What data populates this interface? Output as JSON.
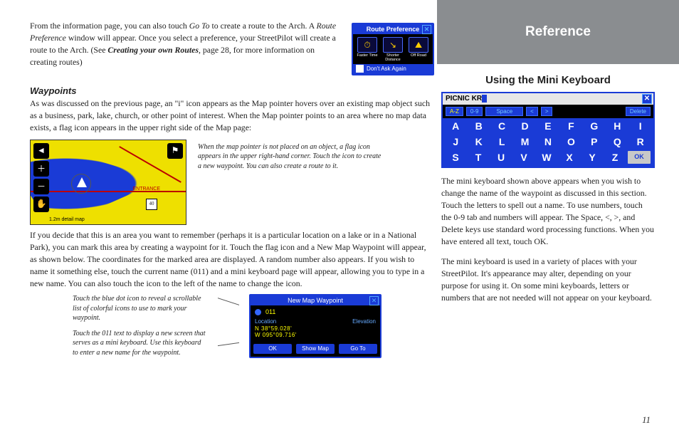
{
  "left": {
    "intro_a": "From the information page, you can also touch ",
    "intro_goto": "Go To",
    "intro_b": " to create a route to the Arch. A ",
    "intro_rp": "Route Preference",
    "intro_c": " window will appear. Once you select a preference, your StreetPilot will create a route to the Arch. (See ",
    "intro_link": "Creating your own Routes",
    "intro_d": ", page 28, for more information on creating routes)",
    "route_pref": {
      "title": "Route Preference",
      "options": [
        "Faster Time",
        "Shorter Distance",
        "Off Road"
      ],
      "glyphs": [
        "⏱",
        "↘",
        "⛰"
      ],
      "dont_ask": "Don't Ask Again"
    },
    "waypoints_h": "Waypoints",
    "waypoints_p1": "As was discussed on the previous page, an \"i\" icon appears as the Map pointer hovers over an existing map object such as a business, park, lake, church, or other point of interest. When the Map pointer points to an area where no map data exists, a flag icon appears in the upper right side of the Map page:",
    "map1": {
      "entrance": "ENTRANCE",
      "scale": "1.2m detail map",
      "shield": "40"
    },
    "cap1": "When the map pointer is not placed on an object, a flag icon appears in the upper right-hand corner. Touch the icon to create a new waypoint. You can also create a route to it.",
    "waypoints_p2_a": "If you decide that this is an area you want to remember (perhaps it is a particular location on a lake or in a National Park), you can mark this area by creating a waypoint for it. Touch the flag icon and a ",
    "waypoints_p2_i": "New Map Waypoint",
    "waypoints_p2_b": " will appear, as shown below. The coordinates for the marked area are displayed. A random number also appears. If you wish to name it something else, touch the current name (011) and a mini keyboard page will appear, allowing you to type in a new name. You can also touch the icon to the left of the name to change the icon.",
    "cap2a": "Touch the blue dot icon to reveal a scrollable list of colorful icons to use to mark your waypoint.",
    "cap2b": "Touch the 011 text to display a new screen that serves as a mini keyboard. Use this keyboard to enter a new name for the waypoint.",
    "nmw": {
      "title": "New Map Waypoint",
      "name": "011",
      "loc_label": "Location",
      "elev_label": "Elevation",
      "lat": "N 38°59.028'",
      "lon": "W 095°09.716'",
      "buttons": [
        "OK",
        "Show Map",
        "Go To"
      ]
    }
  },
  "right": {
    "ref": "Reference",
    "sub": "Using the Mini Keyboard",
    "kbd": {
      "input": "PICNIC KR",
      "tabs": [
        "A-Z",
        "0-9"
      ],
      "space": "Space",
      "lt": "<",
      "gt": ">",
      "del": "Delete",
      "rows": [
        [
          "A",
          "B",
          "C",
          "D",
          "E",
          "F",
          "G",
          "H",
          "I"
        ],
        [
          "J",
          "K",
          "L",
          "M",
          "N",
          "O",
          "P",
          "Q",
          "R"
        ],
        [
          "S",
          "T",
          "U",
          "V",
          "W",
          "X",
          "Y",
          "Z"
        ]
      ],
      "ok": "OK"
    },
    "p1": "The mini keyboard shown above appears when you wish to change the name of the waypoint as discussed in this section. Touch the letters to spell out a name. To use numbers, touch the 0-9 tab and numbers will appear. The Space, <, >, and Delete keys use standard word processing functions. When you have entered all text, touch OK.",
    "p2": "The mini keyboard is used in a variety of places with your StreetPilot. It's appearance may alter, depending on your purpose for using it. On some mini keyboards, letters or numbers that are not needed will not appear on your keyboard."
  },
  "page_no": "11"
}
